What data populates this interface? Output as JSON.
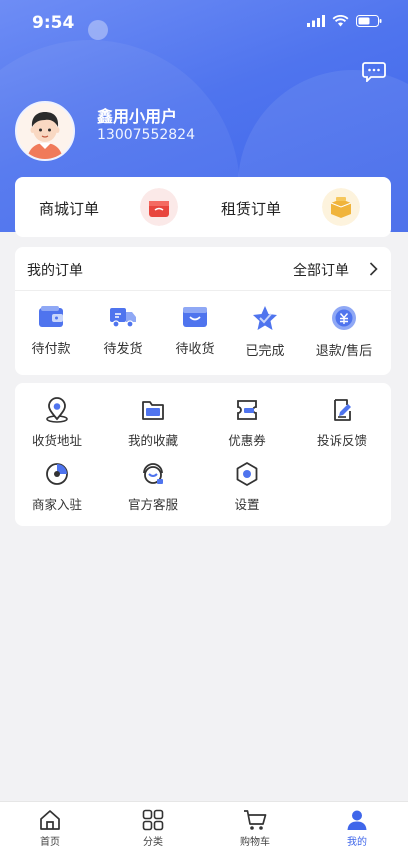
{
  "status_bar": {
    "time": "9:54"
  },
  "colors": {
    "primary": "#4f74ee",
    "accent_red": "#e8463e",
    "accent_gold": "#f0b43c"
  },
  "profile": {
    "username": "鑫用小用户",
    "phone": "13007552824"
  },
  "shop_orders": [
    {
      "label": "商城订单",
      "icon": "shopping-bag-icon"
    },
    {
      "label": "租赁订单",
      "icon": "box-icon"
    }
  ],
  "orders": {
    "title": "我的订单",
    "view_all": "全部订单",
    "items": [
      {
        "label": "待付款",
        "icon": "wallet-icon"
      },
      {
        "label": "待发货",
        "icon": "truck-icon"
      },
      {
        "label": "待收货",
        "icon": "package-icon"
      },
      {
        "label": "已完成",
        "icon": "completed-star-icon"
      },
      {
        "label": "退款/售后",
        "icon": "refund-icon"
      }
    ]
  },
  "services": [
    {
      "label": "收货地址",
      "icon": "location-icon"
    },
    {
      "label": "我的收藏",
      "icon": "folder-icon"
    },
    {
      "label": "优惠券",
      "icon": "coupon-icon"
    },
    {
      "label": "投诉反馈",
      "icon": "feedback-icon"
    },
    {
      "label": "商家入驻",
      "icon": "merchant-icon"
    },
    {
      "label": "官方客服",
      "icon": "customer-service-icon"
    },
    {
      "label": "设置",
      "icon": "settings-icon"
    }
  ],
  "tabbar": [
    {
      "label": "首页",
      "icon": "home-icon",
      "active": false
    },
    {
      "label": "分类",
      "icon": "category-icon",
      "active": false
    },
    {
      "label": "购物车",
      "icon": "cart-icon",
      "active": false
    },
    {
      "label": "我的",
      "icon": "profile-icon",
      "active": true
    }
  ]
}
